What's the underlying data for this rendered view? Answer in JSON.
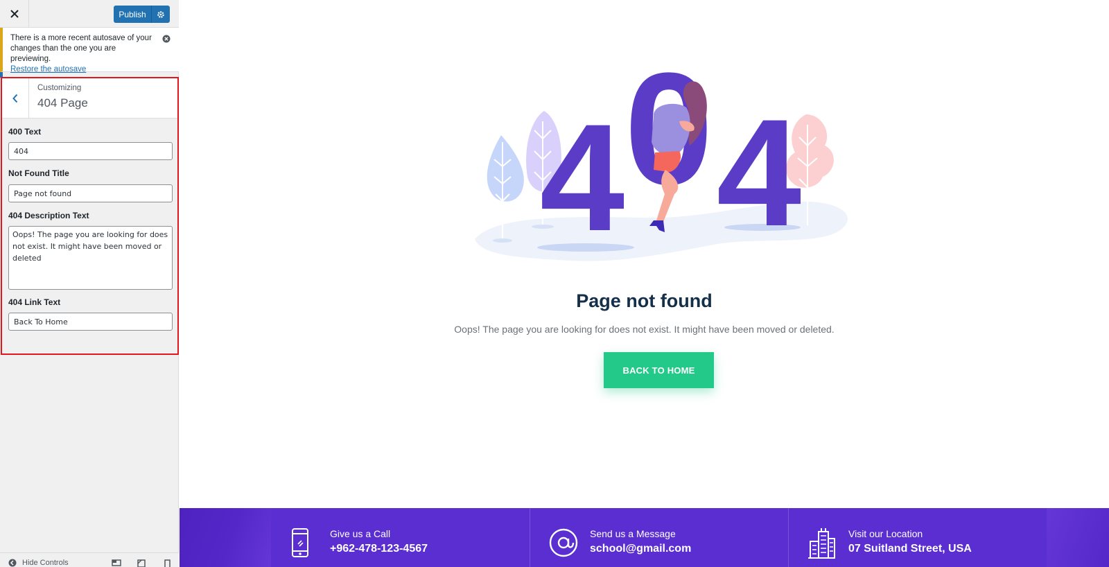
{
  "header": {
    "publish_label": "Publish"
  },
  "notice": {
    "text": "There is a more recent autosave of your changes than the one you are previewing.",
    "link": "Restore the autosave"
  },
  "section": {
    "breadcrumb": "Customizing",
    "title": "404 Page"
  },
  "fields": {
    "text_400": {
      "label": "400 Text",
      "value": "404"
    },
    "not_found_title": {
      "label": "Not Found Title",
      "value": "Page not found"
    },
    "description": {
      "label": "404 Description Text",
      "value": "Oops! The page you are looking for does not exist. It might have been moved or deleted"
    },
    "link_text": {
      "label": "404 Link Text",
      "value": "Back To Home"
    }
  },
  "footer": {
    "hide_controls": "Hide Controls"
  },
  "preview": {
    "digits": [
      "4",
      "0",
      "4"
    ],
    "title": "Page not found",
    "description": "Oops! The page you are looking for does not exist. It might have been moved or deleted.",
    "button": "BACK TO HOME",
    "contacts": [
      {
        "icon": "phone-icon",
        "label": "Give us a Call",
        "value": "+962-478-123-4567"
      },
      {
        "icon": "at-sign-icon",
        "label": "Send us a Message",
        "value": "school@gmail.com"
      },
      {
        "icon": "building-icon",
        "label": "Visit our Location",
        "value": "07 Suitland Street, USA"
      }
    ]
  },
  "colors": {
    "accent_blue": "#2271b1",
    "highlight_red": "#e3161b",
    "digit_purple": "#5a3cc6",
    "button_green": "#22c989",
    "contact_bar": "#5a2ed0",
    "title_navy": "#142f4a"
  }
}
